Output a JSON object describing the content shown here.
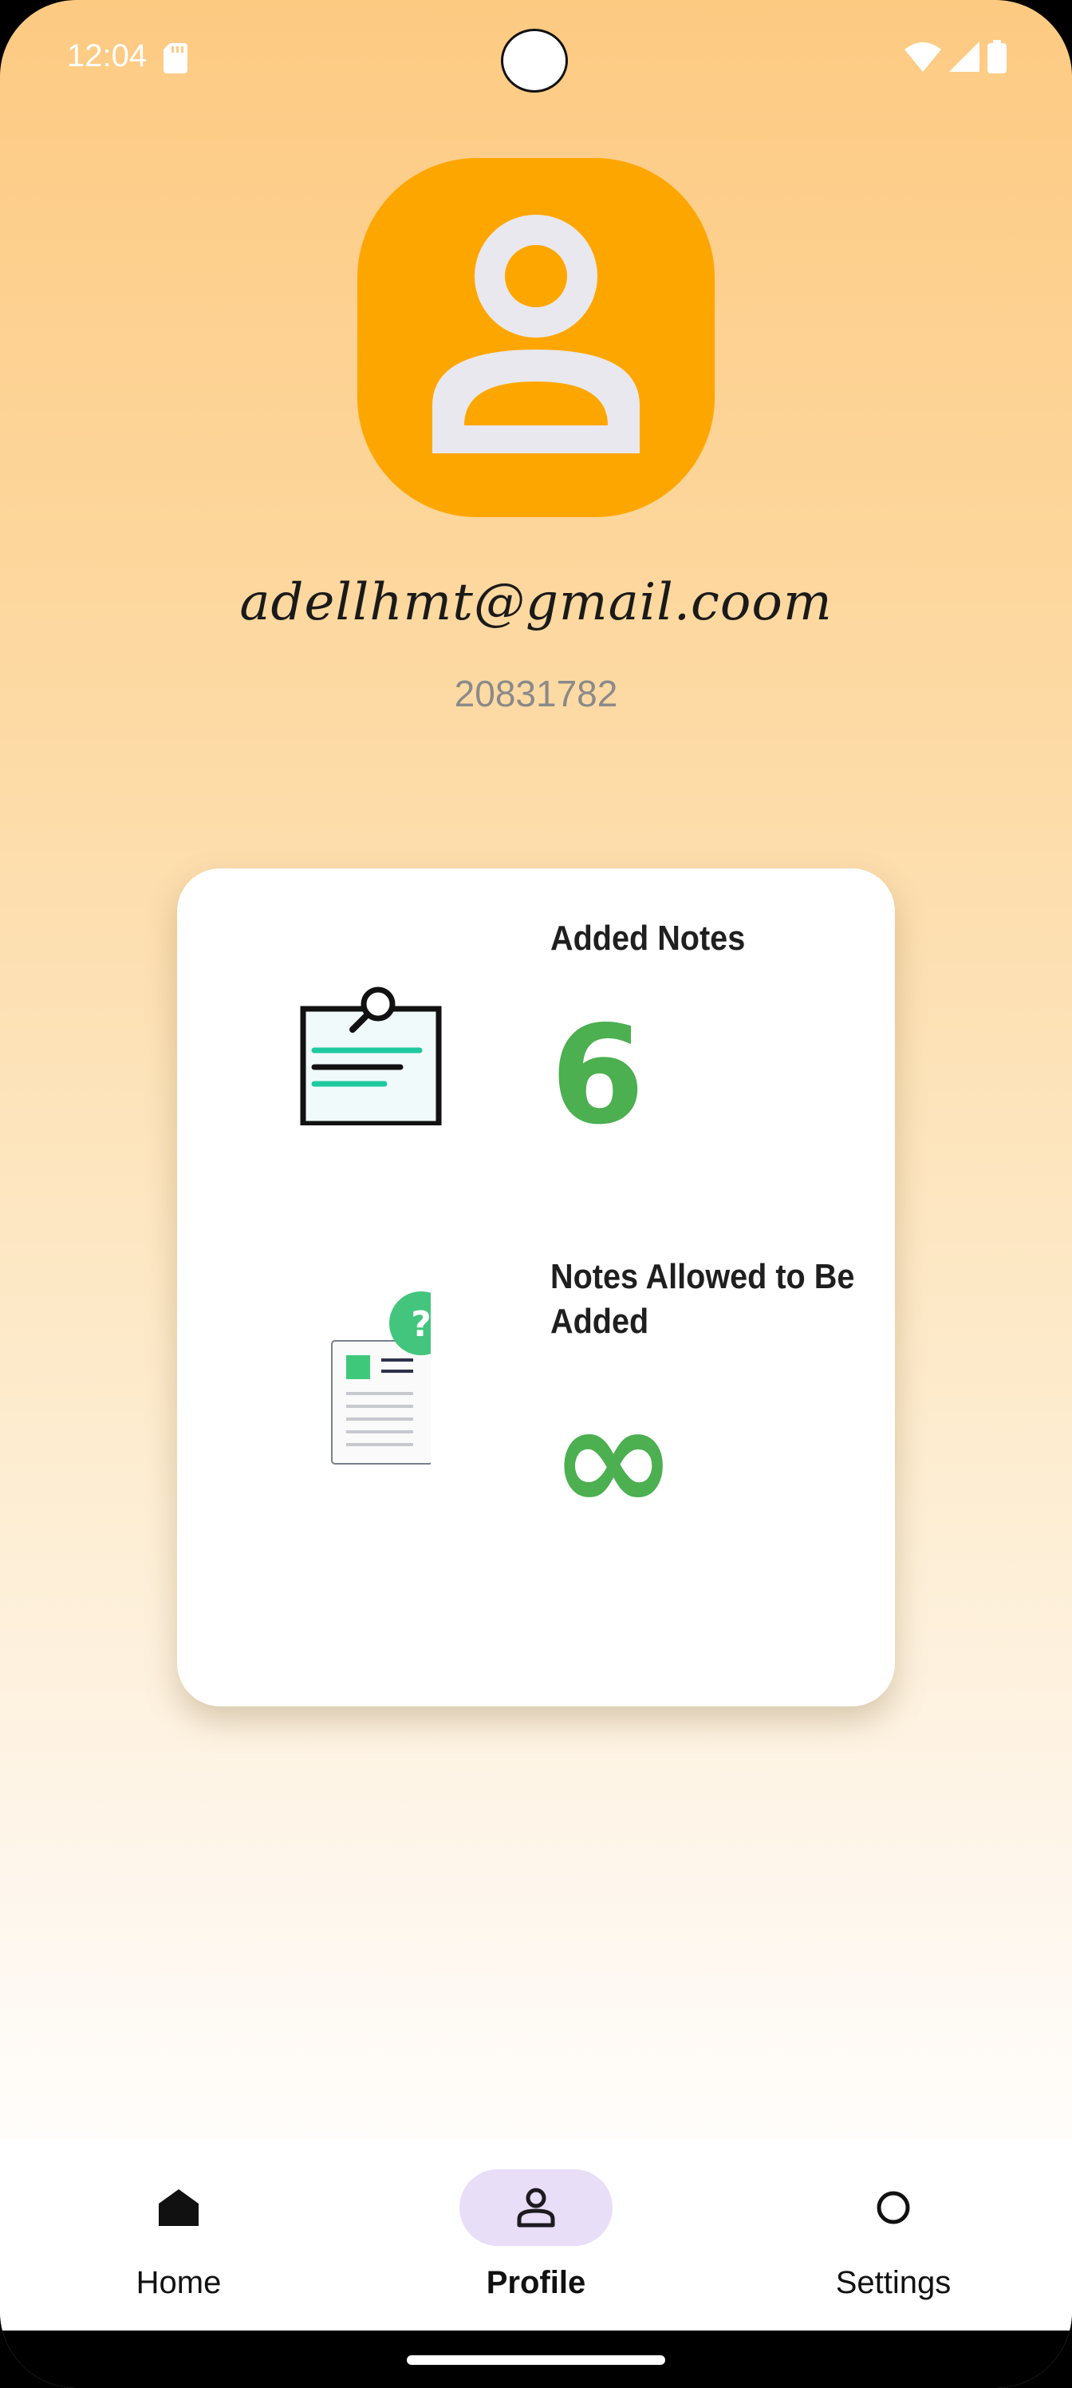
{
  "status_bar": {
    "time": "12:04"
  },
  "profile": {
    "email": "adellhmt@gmail.coom",
    "user_id": "20831782"
  },
  "stats": [
    {
      "label": "Added Notes",
      "value": "6",
      "icon": "clipboard-search-icon"
    },
    {
      "label": "Notes Allowed to Be Added",
      "value": "∞",
      "icon": "document-question-icon"
    }
  ],
  "nav": {
    "items": [
      {
        "label": "Home",
        "icon": "home-icon",
        "active": false
      },
      {
        "label": "Profile",
        "icon": "person-icon",
        "active": true
      },
      {
        "label": "Settings",
        "icon": "circle-icon",
        "active": false
      }
    ]
  },
  "colors": {
    "avatar_bg": "#fea600",
    "accent_green": "#4caf50",
    "active_pill": "#e8def8"
  }
}
